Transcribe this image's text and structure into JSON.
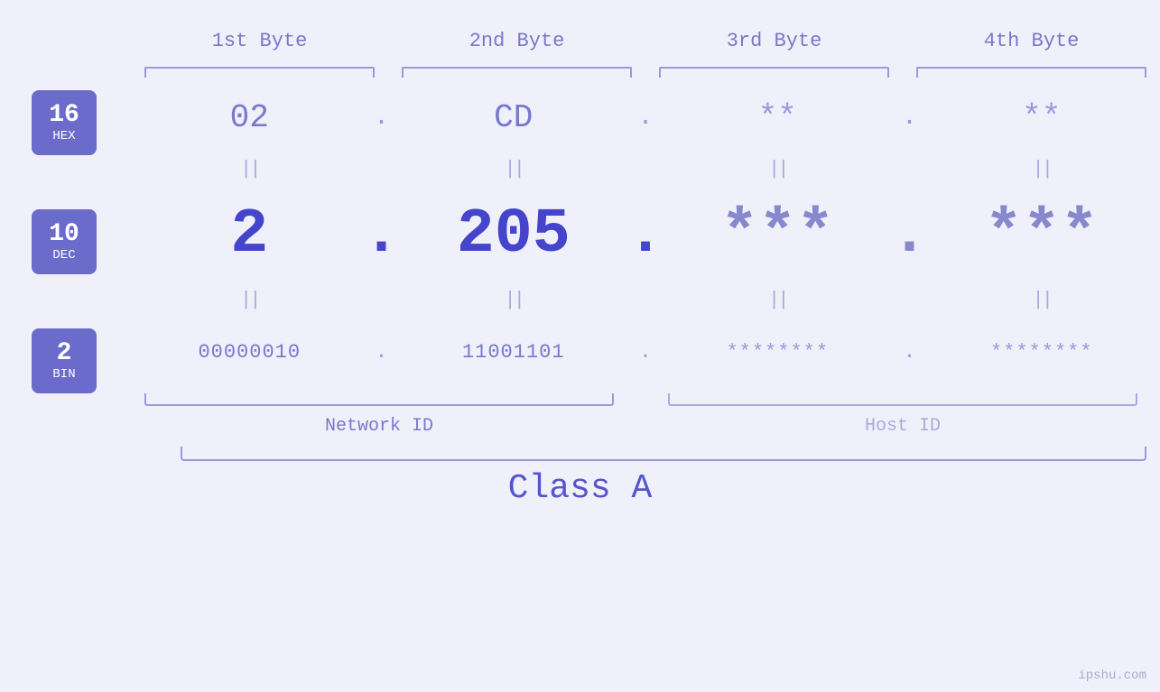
{
  "header": {
    "byte1": "1st Byte",
    "byte2": "2nd Byte",
    "byte3": "3rd Byte",
    "byte4": "4th Byte"
  },
  "badges": {
    "hex": {
      "num": "16",
      "label": "HEX"
    },
    "dec": {
      "num": "10",
      "label": "DEC"
    },
    "bin": {
      "num": "2",
      "label": "BIN"
    }
  },
  "hex_row": {
    "b1": "02",
    "b2": "CD",
    "b3": "**",
    "b4": "**",
    "dots": [
      ".",
      ".",
      "."
    ]
  },
  "dec_row": {
    "b1": "2",
    "b2": "205",
    "b3": "***",
    "b4": "***",
    "dots": [
      ".",
      ".",
      "."
    ]
  },
  "bin_row": {
    "b1": "00000010",
    "b2": "11001101",
    "b3": "********",
    "b4": "********",
    "dots": [
      ".",
      ".",
      "."
    ]
  },
  "labels": {
    "network_id": "Network ID",
    "host_id": "Host ID",
    "class": "Class A"
  },
  "watermark": "ipshu.com",
  "colors": {
    "accent": "#6b6bcc",
    "text_known": "#5555cc",
    "text_masked": "#9999dd",
    "dec_known": "#4444cc",
    "dec_masked": "#8888cc"
  }
}
